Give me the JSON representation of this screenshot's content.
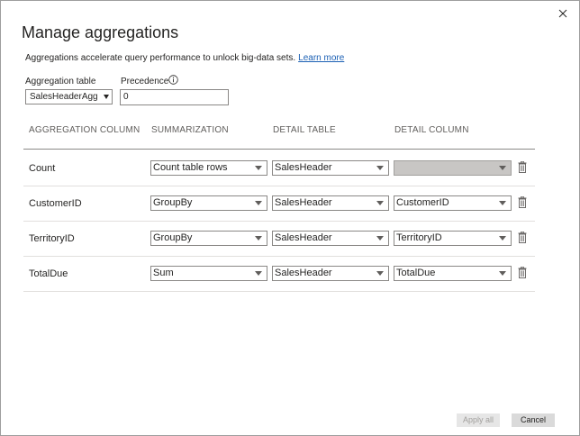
{
  "dialog": {
    "title": "Manage aggregations",
    "description": "Aggregations accelerate query performance to unlock big-data sets.",
    "learn_more": "Learn more",
    "close_icon": "close-icon"
  },
  "controls": {
    "aggregation_table_label": "Aggregation table",
    "aggregation_table_value": "SalesHeaderAgg",
    "precedence_label": "Precedence",
    "precedence_value": "0",
    "info_icon": "info-icon"
  },
  "columns": [
    "AGGREGATION COLUMN",
    "SUMMARIZATION",
    "DETAIL TABLE",
    "DETAIL COLUMN"
  ],
  "rows": [
    {
      "name": "Count",
      "summarization": "Count table rows",
      "detail_table": "SalesHeader",
      "detail_column": "",
      "detail_column_disabled": true
    },
    {
      "name": "CustomerID",
      "summarization": "GroupBy",
      "detail_table": "SalesHeader",
      "detail_column": "CustomerID",
      "detail_column_disabled": false
    },
    {
      "name": "TerritoryID",
      "summarization": "GroupBy",
      "detail_table": "SalesHeader",
      "detail_column": "TerritoryID",
      "detail_column_disabled": false
    },
    {
      "name": "TotalDue",
      "summarization": "Sum",
      "detail_table": "SalesHeader",
      "detail_column": "TotalDue",
      "detail_column_disabled": false
    }
  ],
  "footer": {
    "apply_all": "Apply all",
    "cancel": "Cancel"
  },
  "colors": {
    "link": "#1a5fb4",
    "disabled_dropdown": "#c8c6c4"
  }
}
